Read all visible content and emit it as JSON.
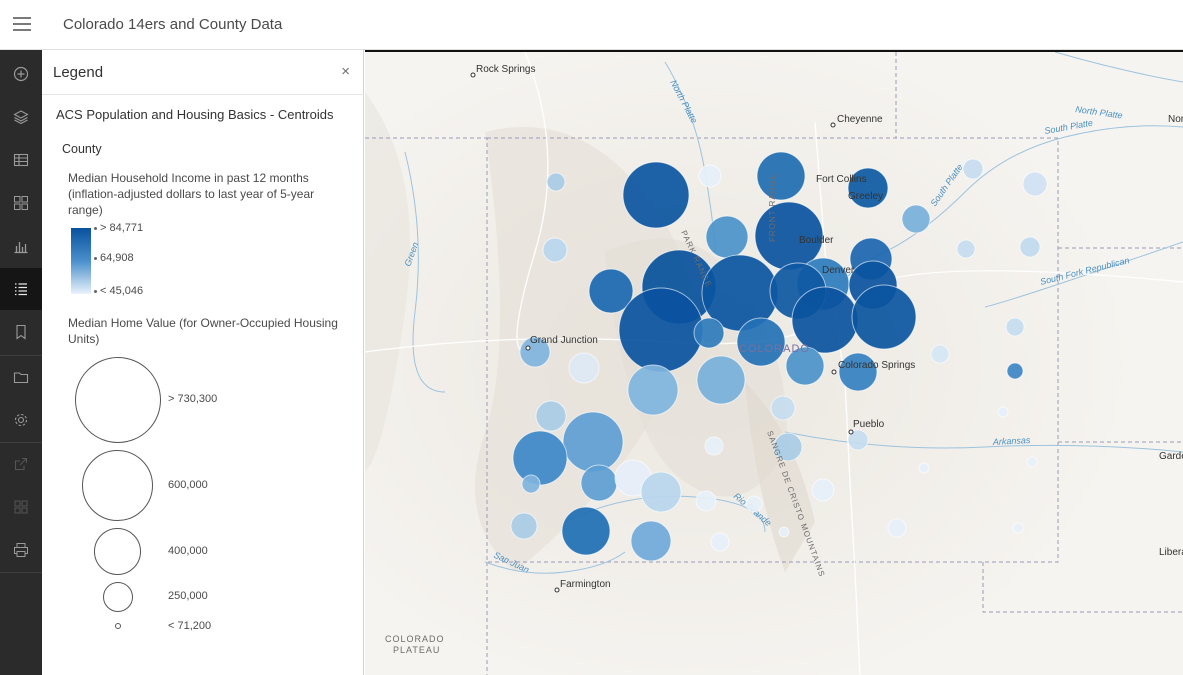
{
  "header": {
    "title": "Colorado 14ers and County Data"
  },
  "toolbar": {
    "icons": [
      "add-data-icon",
      "layers-icon",
      "table-icon",
      "basemap-icon",
      "chart-icon",
      "legend-icon",
      "bookmark-icon",
      "folder-icon",
      "settings-icon",
      "share-icon",
      "grid-icon",
      "print-icon"
    ],
    "active": "legend-icon"
  },
  "legend": {
    "title": "Legend",
    "close_symbol": "×",
    "layer_title": "ACS Population and Housing Basics - Centroids",
    "sublayer": "County",
    "color_field": "Median Household Income in past 12 months (inflation-adjusted dollars to last year of 5-year range)",
    "color_ramp": {
      "high": "> 84,771",
      "mid": "64,908",
      "low": "< 45,046",
      "high_color": "#08519c",
      "low_color": "#eaf2fb"
    },
    "size_field": "Median Home Value (for Owner-Occupied Housing Units)",
    "size_stops": [
      {
        "label": "> 730,300",
        "value": 730300
      },
      {
        "label": "600,000",
        "value": 600000
      },
      {
        "label": "400,000",
        "value": 400000
      },
      {
        "label": "250,000",
        "value": 250000
      },
      {
        "label": "< 71,200",
        "value": 71200
      }
    ]
  },
  "map": {
    "places": [
      "Rock Springs",
      "Cheyenne",
      "Fort Collins",
      "Greeley",
      "Boulder",
      "Denver",
      "Grand Junction",
      "Colorado Springs",
      "Pueblo",
      "Farmington",
      "Liberal",
      "Garden City",
      "North Platte"
    ],
    "region_labels": [
      "COLORADO",
      "COLORADO PLATEAU",
      "SANGRE DE CRISTO MOUNTAINS",
      "FRONT RANGE",
      "PARK RANGE"
    ],
    "rivers": [
      "North Platte",
      "South Platte",
      "South Fork Republican",
      "Green",
      "Arkansas",
      "Rio Grande",
      "San Juan"
    ]
  }
}
